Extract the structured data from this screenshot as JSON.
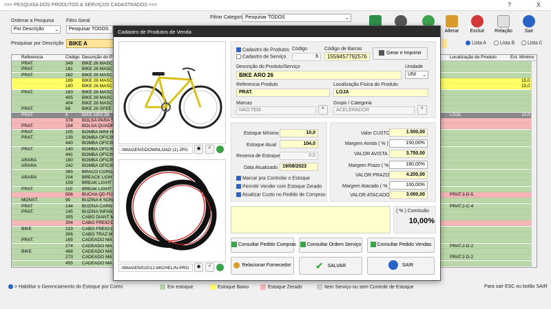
{
  "window": {
    "title": ">>>  PESQUISA DOS PRODUTOS & SERVIÇOS CADASTRADOS  <<<",
    "help": "?",
    "close": "X"
  },
  "filters": {
    "ordenar_label": "Ordenar a Pesquisa",
    "ordenar_value": "Por Descrição",
    "filtro_label": "Filtro Geral",
    "filtro_value": "Pesquisar TODOS",
    "categoria_label": "Filtrar Categoria",
    "categoria_value": "Pesquisar TODOS",
    "pesquisar_label": "Pesquisar por Descrição",
    "pesquisar_value": "BIKE A",
    "lista_a": "Lista A",
    "lista_b": "Lista B",
    "lista_c": "Lista C"
  },
  "toolbar": {
    "alterar": "Alterar",
    "excluir": "Excluir",
    "relacao": "Relação",
    "sair": "Sair"
  },
  "grid": {
    "headers": [
      "Referencia",
      "Código",
      "Descrição do P",
      "Localização do Produto",
      "Est. Mínimo"
    ],
    "rows": [
      {
        "ref": "PRAT.",
        "cod": "349",
        "desc": "BIKE 26 MASC",
        "loc": "",
        "est": "",
        "color": "#b9d7a8"
      },
      {
        "ref": "PRAT.",
        "cod": "181",
        "desc": "BIKE 26 MASC",
        "loc": "",
        "est": "",
        "color": "#b9d7a8"
      },
      {
        "ref": "PRAT.",
        "cod": "262",
        "desc": "BIKE 26 MASC",
        "loc": "",
        "est": "",
        "color": "#b9d7a8"
      },
      {
        "ref": "",
        "cod": "189",
        "desc": "BIKE 26 MASC",
        "loc": "",
        "est": "15,0",
        "color": "#ffff66"
      },
      {
        "ref": "",
        "cod": "190",
        "desc": "BIKE 26 MASC",
        "loc": "",
        "est": "15,0",
        "color": "#ffff66"
      },
      {
        "ref": "PRAT.",
        "cod": "183",
        "desc": "BIKE 26 MASC",
        "loc": "",
        "est": "",
        "color": "#b9d7a8"
      },
      {
        "ref": "",
        "cod": "405",
        "desc": "BIKE 26 MASC",
        "loc": "",
        "est": "",
        "color": "#b9d7a8"
      },
      {
        "ref": "",
        "cod": "404",
        "desc": "BIKE 26 MASC",
        "loc": "",
        "est": "",
        "color": "#b9d7a8"
      },
      {
        "ref": "PRAT.",
        "cod": "68",
        "desc": "BIKE 26 SPEE",
        "loc": "",
        "est": "",
        "color": "#b9d7a8"
      },
      {
        "ref": "PRAT.",
        "cod": "6",
        "desc": "BIKE ARO 26",
        "loc": "LOJA",
        "est": "10,0",
        "color": "#8a8a8a",
        "selected": true
      },
      {
        "ref": "",
        "cod": "378",
        "desc": "BOLSA PARA S",
        "loc": "",
        "est": "",
        "color": "#f4b6b6"
      },
      {
        "ref": "PRAT.",
        "cod": "154",
        "desc": "BOLSA QUADR",
        "loc": "",
        "est": "",
        "color": "#f4b6b6"
      },
      {
        "ref": "PRAT.",
        "cod": "105",
        "desc": "BOMBA MINI H",
        "loc": "",
        "est": "",
        "color": "#b9d7a8"
      },
      {
        "ref": "PRAT.",
        "cod": "139",
        "desc": "BOMBA OFICIN",
        "loc": "",
        "est": "",
        "color": "#b9d7a8"
      },
      {
        "ref": "",
        "cod": "440",
        "desc": "BOMBA OFICIN",
        "loc": "",
        "est": "",
        "color": "#b9d7a8"
      },
      {
        "ref": "PRAT.",
        "cod": "140",
        "desc": "BOMBA OFICIN",
        "loc": "",
        "est": "",
        "color": "#b9d7a8"
      },
      {
        "ref": "",
        "cod": "441",
        "desc": "BOMBA OFICIN",
        "loc": "",
        "est": "",
        "color": "#b9d7a8"
      },
      {
        "ref": "ARARA",
        "cod": "160",
        "desc": "BOMBA OFICIN",
        "loc": "",
        "est": "",
        "color": "#b9d7a8"
      },
      {
        "ref": "ARARA",
        "cod": "242",
        "desc": "BOMBA OFICIN",
        "loc": "",
        "est": "",
        "color": "#b9d7a8"
      },
      {
        "ref": "",
        "cod": "365",
        "desc": "BRACO CORGA",
        "loc": "",
        "est": "",
        "color": "#b9d7a8"
      },
      {
        "ref": "ARARA",
        "cod": "204",
        "desc": "BREACK LIGH",
        "loc": "",
        "est": "",
        "color": "#b9d7a8"
      },
      {
        "ref": "",
        "cod": "109",
        "desc": "BREAK LIGHT",
        "loc": "",
        "est": "",
        "color": "#b9d7a8"
      },
      {
        "ref": "PRAT.",
        "cod": "110",
        "desc": "BREAK LIGHT",
        "loc": "",
        "est": "",
        "color": "#b9d7a8"
      },
      {
        "ref": "",
        "cod": "506",
        "desc": "BUCHA QD FU",
        "loc": "PRAT.3-D-5",
        "est": "",
        "color": "#f4b6b6"
      },
      {
        "ref": "MONST.",
        "cod": "90",
        "desc": "BUZINA 6 SON",
        "loc": "",
        "est": "",
        "color": "#b9d7a8"
      },
      {
        "ref": "PRAT",
        "cod": "144",
        "desc": "BUZINA CARN",
        "loc": "PRAT.2-C-4",
        "est": "",
        "color": "#b9d7a8"
      },
      {
        "ref": "PRAT.",
        "cod": "145",
        "desc": "BUZINA INFAN",
        "loc": "",
        "est": "",
        "color": "#b9d7a8"
      },
      {
        "ref": "",
        "cod": "305",
        "desc": "CABO DIANT M",
        "loc": "",
        "est": "",
        "color": "#b9d7a8"
      },
      {
        "ref": "",
        "cod": "304",
        "desc": "CABO FREIO D",
        "loc": "",
        "est": "",
        "color": "#f4b6b6"
      },
      {
        "ref": "BIKE",
        "cod": "219",
        "desc": "CABO FREIO D",
        "loc": "",
        "est": "",
        "color": "#b9d7a8"
      },
      {
        "ref": "",
        "cod": "306",
        "desc": "CABO TRAZ M",
        "loc": "",
        "est": "",
        "color": "#b9d7a8"
      },
      {
        "ref": "PRAT.",
        "cod": "165",
        "desc": "CADEADO MA",
        "loc": "",
        "est": "",
        "color": "#b9d7a8"
      },
      {
        "ref": "",
        "cod": "274",
        "desc": "CADEADO MA",
        "loc": "PRAT.2-D-2",
        "est": "",
        "color": "#b9d7a8"
      },
      {
        "ref": "BIKE",
        "cod": "468",
        "desc": "CADEADO MA",
        "loc": "",
        "est": "",
        "color": "#b9d7a8"
      },
      {
        "ref": "",
        "cod": "273",
        "desc": "CADEADO MA",
        "loc": "PRAT.2-D-2",
        "est": "",
        "color": "#b9d7a8"
      },
      {
        "ref": "",
        "cod": "455",
        "desc": "CADEADO MA",
        "loc": "",
        "est": "",
        "color": "#b9d7a8"
      }
    ]
  },
  "legend": {
    "habilitar": "> Habilitar o Gerenciamento do Estoque por Cores",
    "em_estoque": "Em estoque",
    "estoque_baixo": "Estoque Baixo",
    "estoque_zerado": "Estoque Zerado",
    "item_servico": "Item Serviço ou sem Controle de Estoque",
    "sair_hint": "Para sair ESC ou botão SAIR"
  },
  "dialog": {
    "title": "Cadastro de Produtos de Venda",
    "image1_path": ".\\IMAGENS\\DOWNLOAD (1).JPG",
    "image2_path": ".\\IMAGENS\\2012-MICHELIN-PRO",
    "cadastro_produtos": "Cadastro de Produtos",
    "cadastro_servico": "Cadastro de Serviço",
    "codigo_label": "Código",
    "codigo_value": "6",
    "barras_label": "Código de Barras",
    "barras_value": "1559457792576",
    "gerar_imprimir": "Gerar e Imprimir",
    "descricao_label": "Descrição do Produto/Serviço",
    "descricao_value": "BIKE ARO 26",
    "unidade_label": "Unidade",
    "unidade_value": "UNI",
    "referencia_label": "Referencia Produto",
    "referencia_value": "PRAT.",
    "localizacao_label": "Localização Física do Produto",
    "localizacao_value": "LOJA",
    "marcas_label": "Marcas",
    "marcas_value": "NAO TEM",
    "grupo_label": "Grupo / Categoria",
    "grupo_value": "ACELERADOR",
    "estoque_minimo_label": "Estoque Mínimo",
    "estoque_minimo_value": "10,0",
    "estoque_atual_label": "Estoque Atual",
    "estoque_atual_value": "104,0",
    "reserva_label": "Reserva de Estoque",
    "reserva_value": "0,0",
    "data_label": "Data Atualizado",
    "data_value": "19/08/2023",
    "marcar_controlar": "Marcar pra Controlar o Estoque",
    "permitir_vender": "Permitir Vender com Estoque Zerado",
    "atualizar_custo": "Atualizar Custo no Pedido de Compras",
    "valor_custo_label": "Valor CUSTO",
    "valor_custo_value": "1.500,00",
    "margem_avista_label": "Margem Avista ( % )",
    "margem_avista_value": "150,00%",
    "valor_avista_label": "VALOR AVISTA",
    "valor_avista_value": "3.750,00",
    "margem_prazo_label": "Margem Prazo ( % )",
    "margem_prazo_value": "180,00%",
    "valor_prazo_label": "VALOR PRAZO",
    "valor_prazo_value": "4.200,00",
    "margem_atacado_label": "Margem Atacado ( % )",
    "margem_atacado_value": "100,00%",
    "valor_atacado_label": "VALOR ATACADO",
    "valor_atacado_value": "3.000,00",
    "comissao_label": "( % ) Comissão",
    "comissao_value": "10,00%",
    "consultar_compras": "Consultar Pedido Compras",
    "consultar_servico": "Consultar Ordem Serviço",
    "consultar_vendas": "Consultar Pedido Vendas",
    "relacionar_fornecedor": "Relacionar Fornecedor",
    "salvar": "SALVAR",
    "sair": "SAIR"
  }
}
